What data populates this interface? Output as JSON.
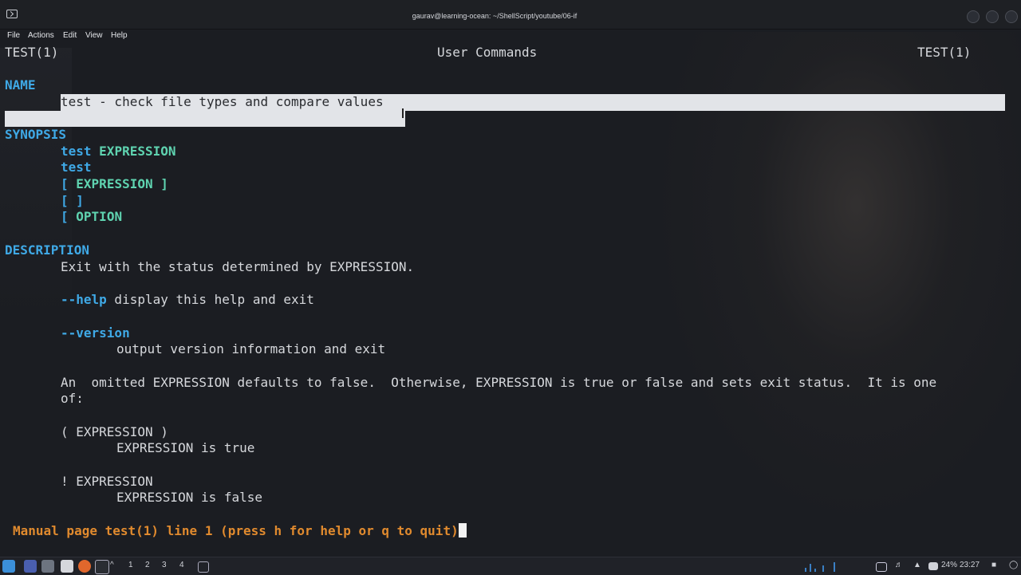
{
  "window": {
    "title": "gaurav@learning-ocean: ~/ShellScript/youtube/06-if"
  },
  "menu": [
    "File",
    "Actions",
    "Edit",
    "View",
    "Help"
  ],
  "man": {
    "header_left": "TEST(1)",
    "header_center": "User Commands",
    "header_right": "TEST(1)",
    "name_heading": "NAME",
    "name_text": "test - check file types and compare values",
    "synopsis_heading": "SYNOPSIS",
    "synopsis": [
      {
        "cmd": "test",
        "arg": "EXPRESSION"
      },
      {
        "cmd": "test",
        "arg": ""
      },
      {
        "cmd": "[",
        "arg": "EXPRESSION ]"
      },
      {
        "cmd": "[ ]",
        "arg": ""
      },
      {
        "cmd": "[",
        "arg": "OPTION"
      }
    ],
    "description_heading": "DESCRIPTION",
    "desc_line1": "Exit with the status determined by EXPRESSION.",
    "help_opt": "--help",
    "help_text": " display this help and exit",
    "version_opt": "--version",
    "version_text": "output version information and exit",
    "omitted_line1": "An  omitted EXPRESSION defaults to false.  Otherwise, EXPRESSION is true or false and sets exit status.  It is one",
    "omitted_line2": "of:",
    "expr_paren": "( EXPRESSION )",
    "expr_paren_desc": "EXPRESSION is true",
    "expr_not": "! EXPRESSION",
    "expr_not_desc": "EXPRESSION is false",
    "status_line": "Manual page test(1) line 1 (press h for help or q to quit)"
  },
  "taskbar": {
    "workspaces": [
      "1",
      "2",
      "3",
      "4"
    ],
    "battery": "24%",
    "time": "23:27"
  },
  "colors": {
    "heading": "#3fa9e6",
    "argument": "#5fd3b0",
    "status": "#e08a2e",
    "background": "#1b1d22"
  }
}
